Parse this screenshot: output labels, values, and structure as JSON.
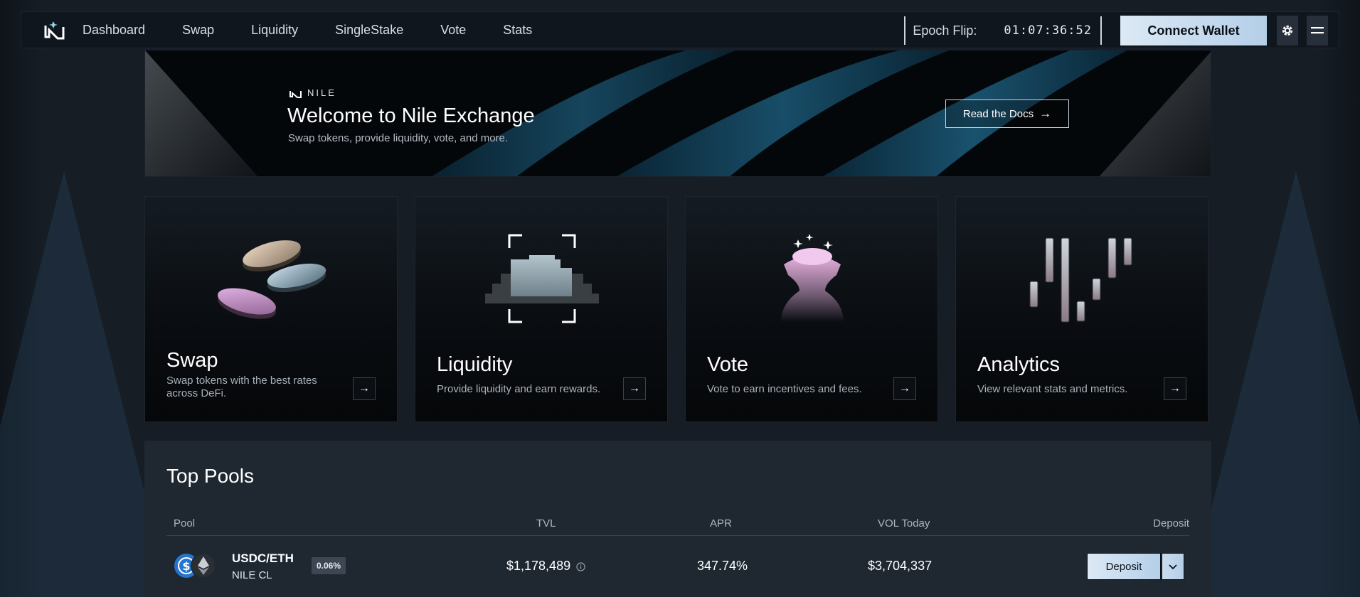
{
  "nav": {
    "links": [
      "Dashboard",
      "Swap",
      "Liquidity",
      "SingleStake",
      "Vote",
      "Stats"
    ],
    "epoch_label": "Epoch Flip:",
    "epoch_time": "01:07:36:52",
    "connect_label": "Connect Wallet"
  },
  "banner": {
    "brand": "NILE",
    "title": "Welcome to Nile Exchange",
    "subtitle": "Swap tokens, provide liquidity, vote, and more.",
    "docs_label": "Read the Docs"
  },
  "cards": [
    {
      "title": "Swap",
      "desc": "Swap tokens with the best rates across DeFi."
    },
    {
      "title": "Liquidity",
      "desc": "Provide liquidity and earn rewards."
    },
    {
      "title": "Vote",
      "desc": "Vote to earn incentives and fees."
    },
    {
      "title": "Analytics",
      "desc": "View relevant stats and metrics."
    }
  ],
  "pools": {
    "title": "Top Pools",
    "headers": {
      "pool": "Pool",
      "tvl": "TVL",
      "apr": "APR",
      "vol": "VOL Today",
      "deposit": "Deposit"
    },
    "rows": [
      {
        "pair": "USDC/ETH",
        "type": "NILE CL",
        "fee": "0.06%",
        "tvl": "$1,178,489",
        "apr": "347.74%",
        "vol": "$3,704,337",
        "deposit_label": "Deposit"
      }
    ]
  },
  "colors": {
    "accent": "#b4cfe8",
    "background": "#161d25",
    "card_bg": "#0a0d11",
    "pools_bg": "#1f2831"
  }
}
